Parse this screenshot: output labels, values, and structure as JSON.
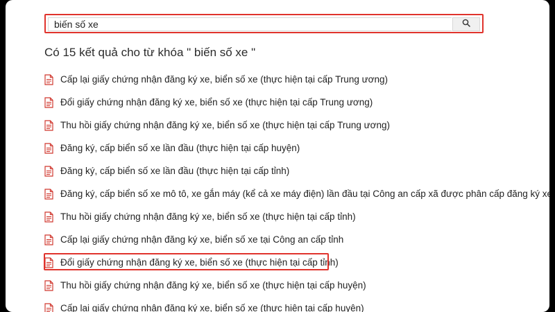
{
  "search": {
    "value": "biến số xe",
    "button_icon": "search-icon"
  },
  "results_heading": "Có 15 kết quả cho từ khóa \" biến số xe \"",
  "accent_color": "#e0332c",
  "results": [
    {
      "label": "Cấp lại giấy chứng nhận đăng ký xe, biển số xe (thực hiện tại cấp Trung ương)",
      "icon": "document-icon"
    },
    {
      "label": "Đổi giấy chứng nhận đăng ký xe, biển số xe (thực hiện tại cấp Trung ương)",
      "icon": "document-icon"
    },
    {
      "label": "Thu hồi giấy chứng nhận đăng ký xe, biển số xe (thực hiện tại cấp Trung ương)",
      "icon": "document-icon"
    },
    {
      "label": "Đăng ký, cấp biển số xe lần đầu (thực hiện tại cấp huyện)",
      "icon": "document-icon"
    },
    {
      "label": "Đăng ký, cấp biển số xe lần đầu (thực hiện tại cấp tỉnh)",
      "icon": "document-icon"
    },
    {
      "label": "Đăng ký, cấp biển số xe mô tô, xe gắn máy (kể cả xe máy điện) lần đầu tại Công an cấp xã được phân cấp đăng ký xe",
      "icon": "document-icon"
    },
    {
      "label": "Thu hồi giấy chứng nhận đăng ký xe, biển số xe (thực hiện tại cấp tỉnh)",
      "icon": "document-icon"
    },
    {
      "label": "Cấp lại giấy chứng nhận đăng ký xe, biển số xe tại Công an cấp tỉnh",
      "icon": "document-icon"
    },
    {
      "label": "Đổi giấy chứng nhận đăng ký xe, biển số xe (thực hiện tại cấp tỉnh)",
      "icon": "document-icon",
      "highlighted": true
    },
    {
      "label": "Thu hồi giấy chứng nhận đăng ký xe, biển số xe (thực hiện tại cấp huyện)",
      "icon": "document-icon"
    },
    {
      "label": "Cấp lại giấy chứng nhận đăng ký xe, biển số xe (thực hiện tại cấp huyện)",
      "icon": "document-icon"
    }
  ]
}
